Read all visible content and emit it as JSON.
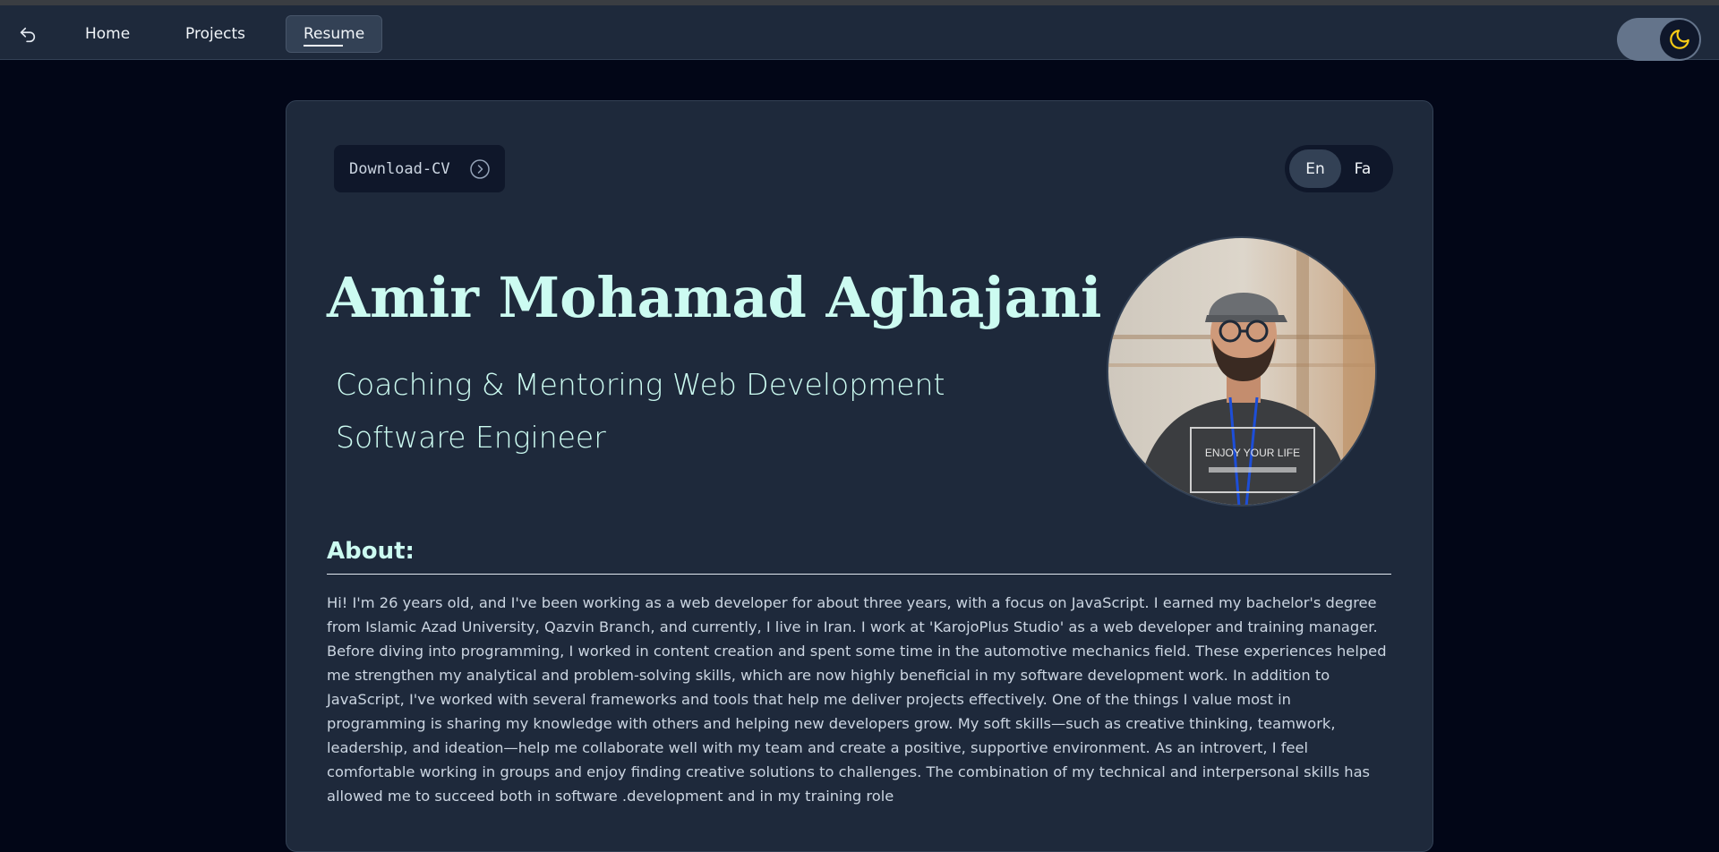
{
  "nav": {
    "back_icon": "back-arrow-icon",
    "links": [
      {
        "label": "Home"
      },
      {
        "label": "Projects"
      },
      {
        "label": "Resume"
      }
    ],
    "active": "Resume",
    "theme_icon": "moon-icon",
    "theme": "dark"
  },
  "resume": {
    "download_label": "Download-CV",
    "download_icon": "chevron-right-circle-icon",
    "languages": [
      "En",
      "Fa"
    ],
    "selected_language": "En",
    "name": "Amir Mohamad Aghajani",
    "subtitles": [
      "Coaching & Mentoring Web Development",
      "Software Engineer"
    ],
    "avatar_shirt_text": "ENJOY YOUR LIFE",
    "about_heading": "About:",
    "about_text": "Hi! I'm 26 years old, and I've been working as a web developer for about three years, with a focus on JavaScript. I earned my bachelor's degree from Islamic Azad University, Qazvin Branch, and currently, I live in Iran. I work at 'KarojoPlus Studio' as a web developer and training manager. Before diving into programming, I worked in content creation and spent some time in the automotive mechanics field. These experiences helped me strengthen my analytical and problem-solving skills, which are now highly beneficial in my software development work. In addition to JavaScript, I've worked with several frameworks and tools that help me deliver projects effectively. One of the things I value most in programming is sharing my knowledge with others and helping new developers grow. My soft skills—such as creative thinking, teamwork, leadership, and ideation—help me collaborate well with my team and create a positive, supportive environment. As an introvert, I feel comfortable working in groups and enjoy finding creative solutions to challenges. The combination of my technical and interpersonal skills has allowed me to succeed both in software .development and in my training role"
  },
  "colors": {
    "page_bg": "#020617",
    "navbar_bg": "#1e293b",
    "card_bg": "#1e293b",
    "accent_text": "#ccfbf1",
    "moon": "#facc15"
  }
}
